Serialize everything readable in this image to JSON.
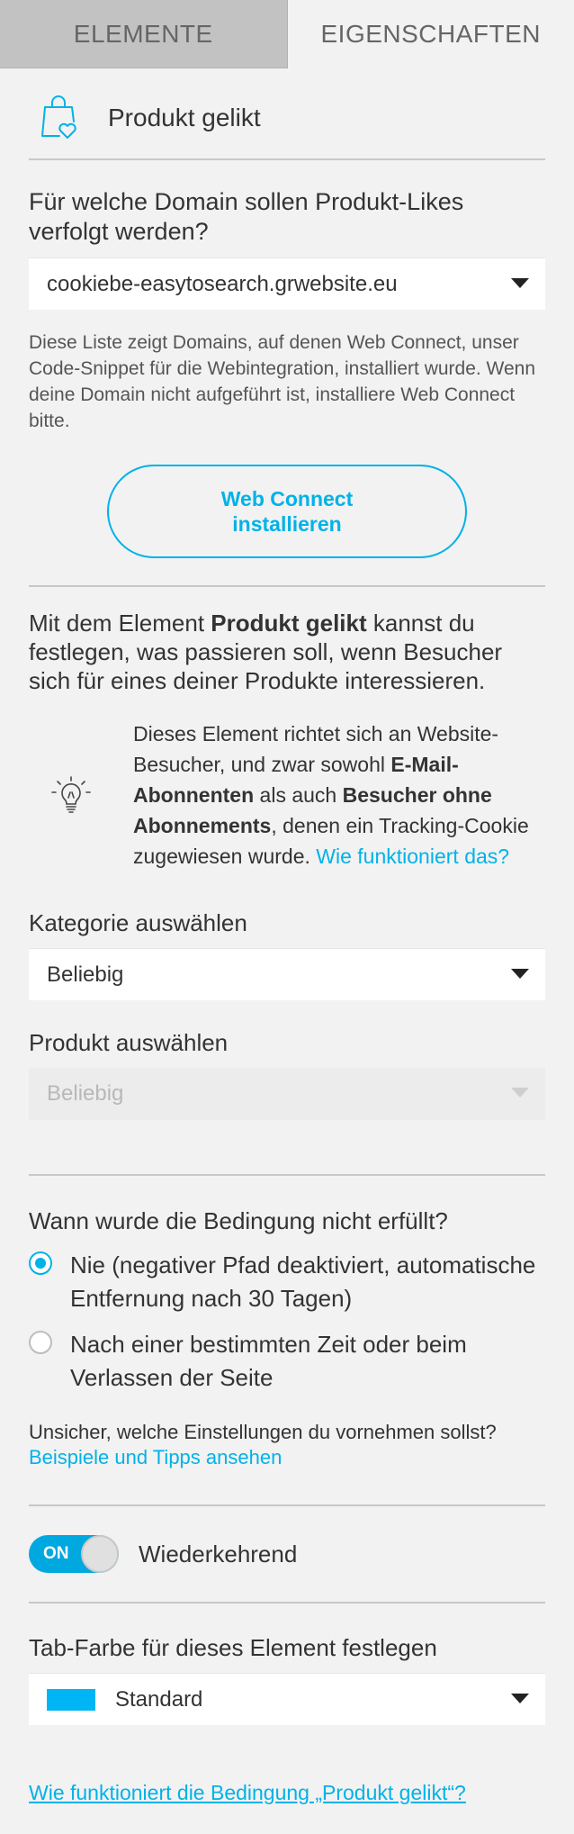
{
  "tabs": [
    {
      "label": "ELEMENTE"
    },
    {
      "label": "EIGENSCHAFTEN"
    }
  ],
  "header": {
    "title": "Produkt gelikt",
    "icon": "shopping-bag-heart-icon"
  },
  "domain": {
    "question": "Für welche Domain sollen Produkt-Likes verfolgt werden?",
    "selected": "cookiebe-easytosearch.grwebsite.eu",
    "info": "Diese Liste zeigt Domains, auf denen Web Connect, unser Code-Snippet für die Webintegration, installiert wurde. Wenn deine Domain nicht aufgeführt ist, installiere Web Connect bitte.",
    "install_button_line1": "Web Connect",
    "install_button_line2": "installieren"
  },
  "intro": {
    "prefix": "Mit dem Element ",
    "bold": "Produkt gelikt",
    "suffix": " kannst du festlegen, was passieren soll, wenn Besucher sich für eines deiner Produkte interessieren."
  },
  "tip": {
    "icon": "lightbulb-icon",
    "part1": "Dieses Element richtet sich an Website-Besucher, und zwar sowohl ",
    "bold1": "E-Mail-Abonnenten",
    "part2": " als auch ",
    "bold2": "Besucher ohne Abonnements",
    "part3": ", denen ein Tracking-Cookie zugewiesen wurde. ",
    "link": "Wie funktioniert das?"
  },
  "category": {
    "label": "Kategorie auswählen",
    "selected": "Beliebig"
  },
  "product": {
    "label": "Produkt auswählen",
    "selected": "Beliebig"
  },
  "condition": {
    "question": "Wann wurde die Bedingung nicht erfüllt?",
    "options": [
      {
        "label": "Nie (negativer Pfad deaktiviert, automatische Entfernung nach 30 Tagen)",
        "checked": true
      },
      {
        "label": "Nach einer bestimmten Zeit oder beim Verlassen der Seite",
        "checked": false
      }
    ],
    "hint": "Unsicher, welche Einstellungen du vornehmen sollst?",
    "hint_link": "Beispiele und Tipps ansehen"
  },
  "recurring": {
    "toggle_text": "ON",
    "label": "Wiederkehrend",
    "on": true
  },
  "tab_color": {
    "label": "Tab-Farbe für dieses Element festlegen",
    "selected": "Standard",
    "swatch_color": "#00b5f5"
  },
  "footer": {
    "link": "Wie funktioniert die Bedingung „Produkt gelikt“?"
  },
  "colors": {
    "accent": "#00b2e8",
    "background": "#f2f2f2",
    "tab_inactive": "#c2c2c2"
  }
}
